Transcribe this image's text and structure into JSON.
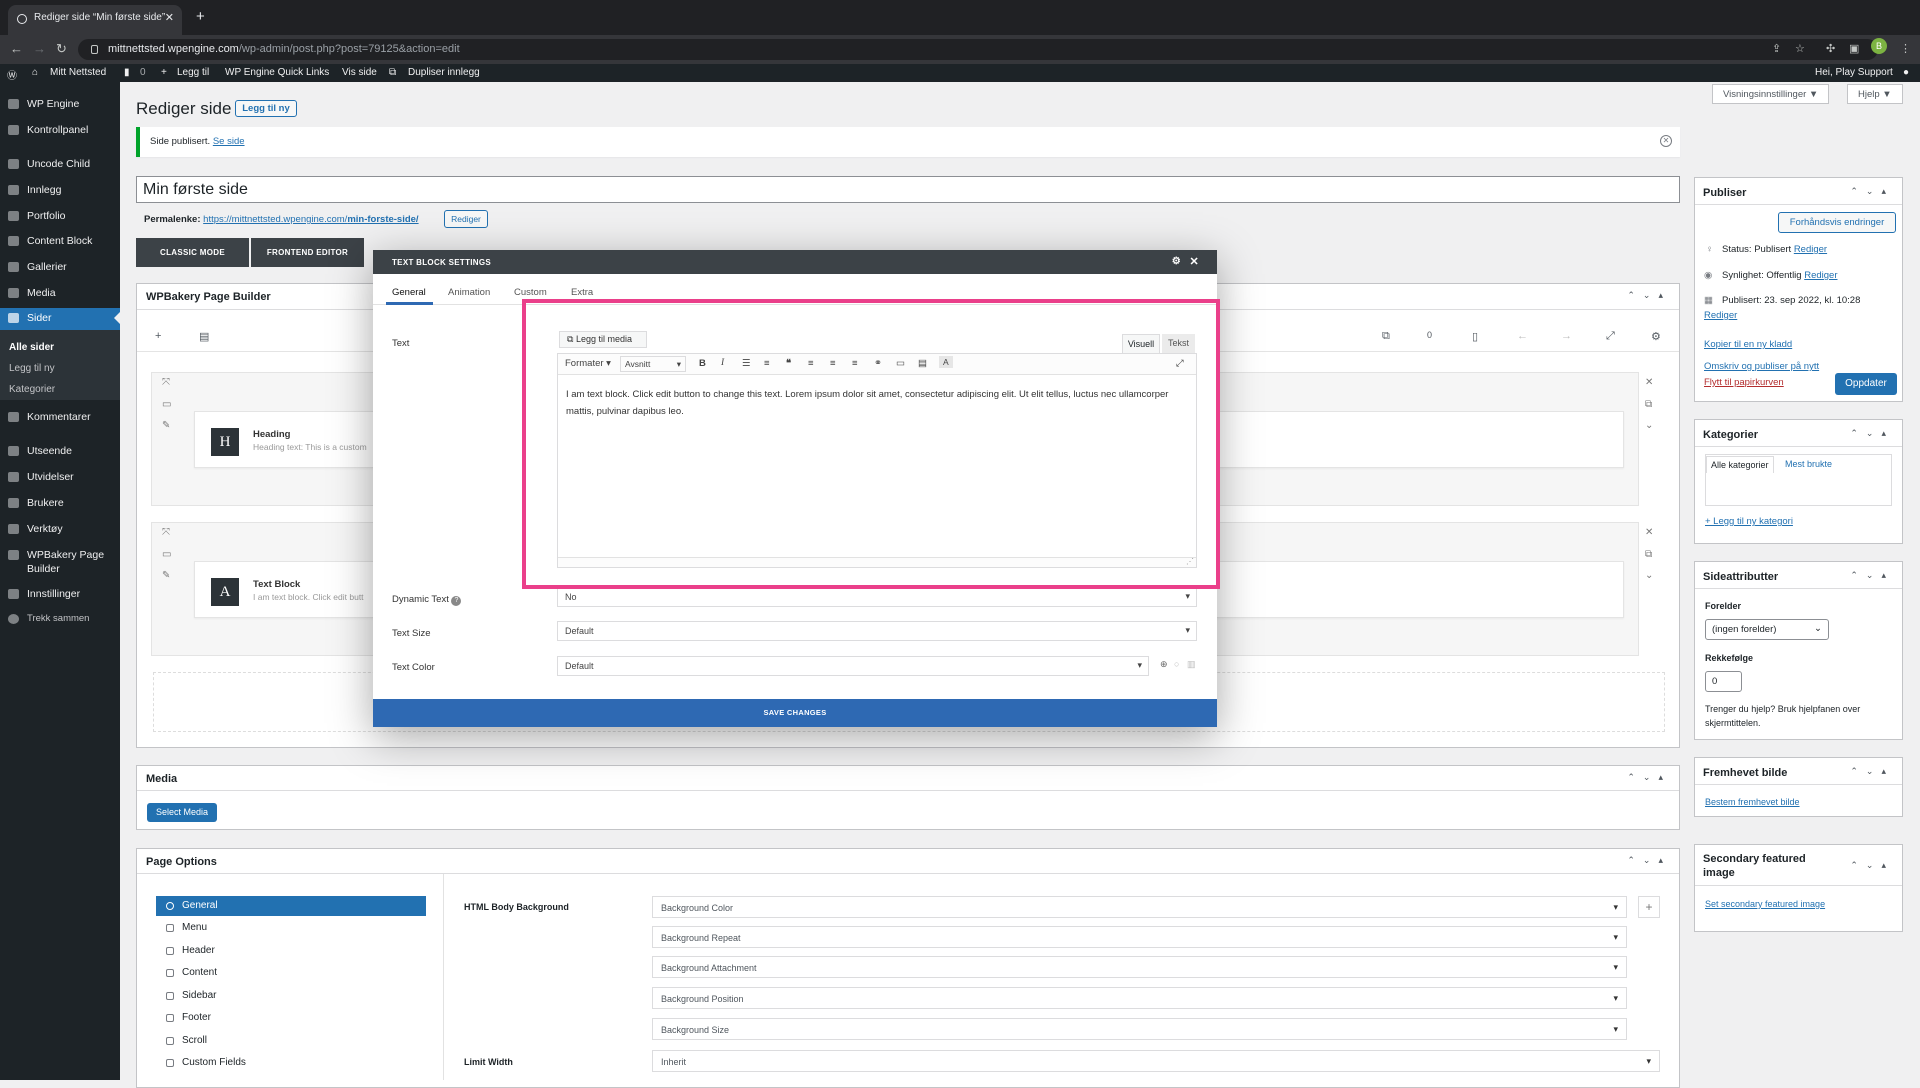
{
  "browser": {
    "tab_title": "Rediger side “Min første side”",
    "url_host": "mittnettsted.wpengine.com",
    "url_path": "/wp-admin/post.php?post=79125&action=edit",
    "profile_initial": "B"
  },
  "adminbar": {
    "site": "Mitt Nettsted",
    "comments": "0",
    "new": "Legg til",
    "quicklinks": "WP Engine Quick Links",
    "view": "Vis side",
    "duplicate": "Dupliser innlegg",
    "greeting": "Hei, Play Support"
  },
  "menu": [
    {
      "label": "WP Engine"
    },
    {
      "label": "Kontrollpanel"
    },
    {
      "label": "Uncode Child"
    },
    {
      "label": "Innlegg"
    },
    {
      "label": "Portfolio"
    },
    {
      "label": "Content Block"
    },
    {
      "label": "Gallerier"
    },
    {
      "label": "Media"
    },
    {
      "label": "Sider"
    },
    {
      "label": "Kommentarer"
    },
    {
      "label": "Utseende"
    },
    {
      "label": "Utvidelser"
    },
    {
      "label": "Brukere"
    },
    {
      "label": "Verktøy"
    },
    {
      "label": "WPBakery Page"
    },
    {
      "label": "Builder"
    },
    {
      "label": "Innstillinger"
    },
    {
      "label": "Trekk sammen"
    }
  ],
  "submenu": [
    "Alle sider",
    "Legg til ny",
    "Kategorier"
  ],
  "page": {
    "title": "Rediger side",
    "add_new": "Legg til ny",
    "screen_options": "Visningsinnstillinger ▼",
    "help": "Hjelp ▼",
    "notice": "Side publisert.",
    "notice_link": "Se side",
    "post_title": "Min første side",
    "perma_label": "Permalenke:",
    "perma_url_base": "https://mittnettsted.wpengine.com/",
    "perma_slug": "min-forste-side/",
    "perma_edit": "Rediger",
    "classic_mode": "CLASSIC MODE",
    "frontend_editor": "FRONTEND EDITOR"
  },
  "wpbakery": {
    "title": "WPBakery Page Builder",
    "counter": "0",
    "heading_name": "Heading",
    "heading_desc": "Heading text: This is a custom",
    "text_name": "Text Block",
    "text_desc": "I am text block. Click edit butt"
  },
  "modal": {
    "title": "TEXT BLOCK SETTINGS",
    "tabs": [
      "General",
      "Animation",
      "Custom",
      "Extra"
    ],
    "text_label": "Text",
    "add_media": "Legg til media",
    "visual_tab": "Visuell",
    "text_tab": "Tekst",
    "format": "Formater ▾",
    "paragraph": "Avsnitt",
    "content": "I am text block. Click edit button to change this text. Lorem ipsum dolor sit amet, consectetur adipiscing elit. Ut elit tellus, luctus nec ullamcorper mattis, pulvinar dapibus leo.",
    "dynamic_label": "Dynamic Text",
    "dynamic_value": "No",
    "size_label": "Text Size",
    "size_value": "Default",
    "color_label": "Text Color",
    "color_value": "Default",
    "save": "SAVE CHANGES"
  },
  "media_box": {
    "title": "Media",
    "button": "Select Media"
  },
  "page_options": {
    "title": "Page Options",
    "items": [
      "General",
      "Menu",
      "Header",
      "Content",
      "Sidebar",
      "Footer",
      "Scroll",
      "Custom Fields"
    ],
    "body_bg_label": "HTML Body Background",
    "selects": [
      "Background Color",
      "Background Repeat",
      "Background Attachment",
      "Background Position",
      "Background Size"
    ],
    "limit_label": "Limit Width",
    "limit_value": "Inherit"
  },
  "publish": {
    "title": "Publiser",
    "preview": "Forhåndsvis endringer",
    "status": "Status: Publisert",
    "visibility": "Synlighet: Offentlig",
    "published": "Publisert: 23. sep 2022, kl. 10:28",
    "edit": "Rediger",
    "copy_draft": "Kopier til en ny kladd",
    "rewrite": "Omskriv og publiser på nytt",
    "trash": "Flytt til papirkurven",
    "update": "Oppdater"
  },
  "categories": {
    "title": "Kategorier",
    "tab_all": "Alle kategorier",
    "tab_used": "Mest brukte",
    "add": "+ Legg til ny kategori"
  },
  "attributes": {
    "title": "Sideattributter",
    "parent_label": "Forelder",
    "parent_value": "(ingen forelder)",
    "order_label": "Rekkefølge",
    "order_value": "0",
    "help": "Trenger du hjelp? Bruk hjelpfanen over skjermtittelen."
  },
  "featured": {
    "title": "Fremhevet bilde",
    "link": "Bestem fremhevet bilde"
  },
  "secondary": {
    "title": "Secondary featured image",
    "link": "Set secondary featured image"
  },
  "colors": {
    "highlight": "#ea3f8a",
    "primary": "#2271b1",
    "modal_header": "#3c4247",
    "save_bar": "#2e69b3"
  }
}
